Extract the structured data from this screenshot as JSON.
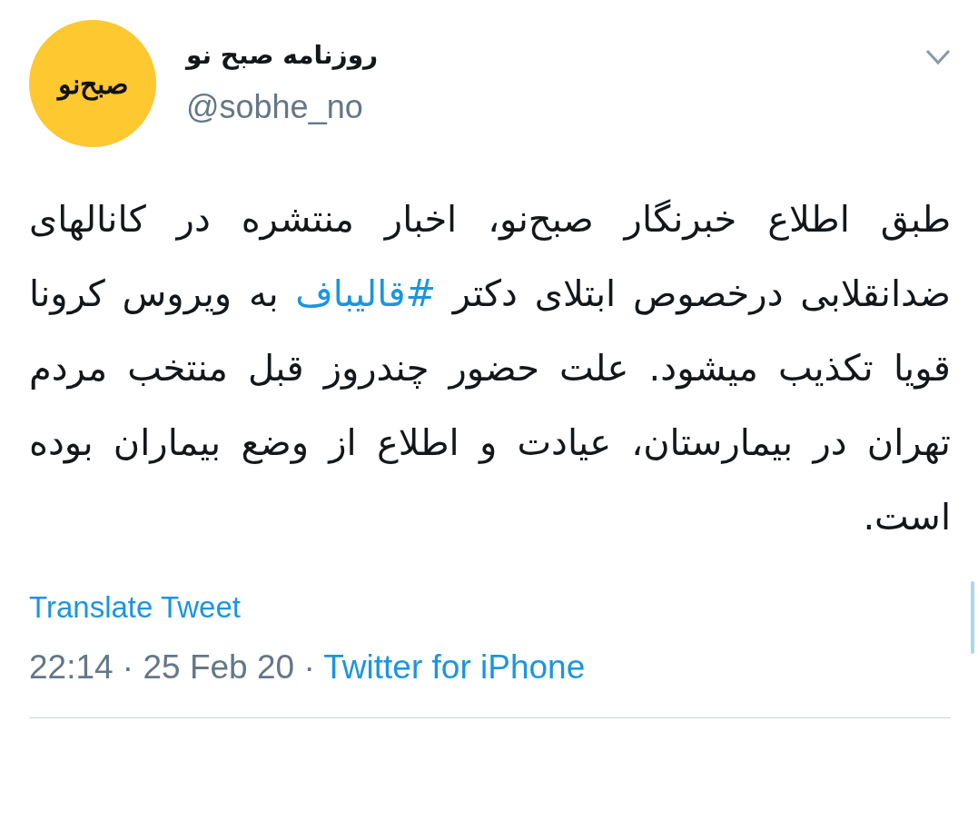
{
  "account": {
    "logo_text": "صبح‌نو",
    "name": "روزنامه صبح نو",
    "handle": "@sobhe_no"
  },
  "tweet": {
    "parts": [
      {
        "kind": "text",
        "text": "طبق اطلاع خبرنگار صبح‌نو، اخبار منتشره در کانالهای ضدانقلابی درخصوص ابتلای دکتر "
      },
      {
        "kind": "hashtag",
        "text": "#قالیباف"
      },
      {
        "kind": "text",
        "text": " به ویروس کرونا قویا تکذیب میشود. علت حضور چندروز قبل منتخب مردم تهران در بیمارستان، عیادت و اطلاع از وضع بیماران بوده است."
      }
    ],
    "translate": "Translate Tweet",
    "time": "22:14 · 25 Feb 20 · ",
    "source": "Twitter for iPhone"
  }
}
